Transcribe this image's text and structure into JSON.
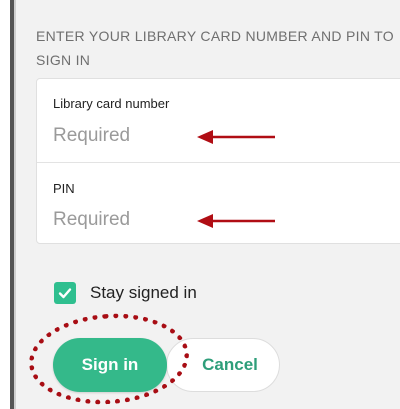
{
  "instructions": "ENTER YOUR LIBRARY CARD NUMBER AND PIN TO SIGN IN",
  "fields": [
    {
      "label": "Library card number",
      "placeholder": "Required"
    },
    {
      "label": "PIN",
      "placeholder": "Required"
    }
  ],
  "stay_signed_in": {
    "label": "Stay signed in",
    "checked": true
  },
  "buttons": {
    "sign_in": "Sign in",
    "cancel": "Cancel"
  },
  "colors": {
    "accent": "#34b98a",
    "checkbox": "#2fbf8f",
    "cancel_text": "#2e9e7a",
    "annotation": "#a80d14"
  },
  "icons": [
    "checkmark-icon",
    "arrow-left-icon"
  ]
}
